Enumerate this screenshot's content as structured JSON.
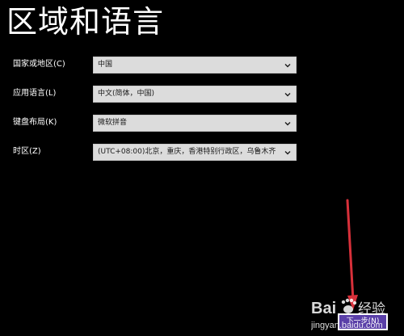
{
  "page": {
    "title": "区域和语言"
  },
  "fields": [
    {
      "label": "国家或地区(C)",
      "value": "中国"
    },
    {
      "label": "应用语言(L)",
      "value": "中文(简体，中国)"
    },
    {
      "label": "键盘布局(K)",
      "value": "微软拼音"
    },
    {
      "label": "时区(Z)",
      "value": "(UTC+08:00)北京，重庆，香港特别行政区，乌鲁木齐"
    }
  ],
  "actions": {
    "next_label": "下一步(N)"
  },
  "watermark": {
    "brand": "Bai",
    "brand_suffix": "经验",
    "url": "jingyan.baidu.com"
  },
  "colors": {
    "background": "#000000",
    "dropdown_bg": "#dcdcdc",
    "next_button_bg": "#5a3fa8",
    "arrow": "#d8303a"
  },
  "icons": {
    "dropdown": "chevron-down-icon",
    "arrow": "red-arrow-annotation",
    "logo": "baidu-paw-icon"
  }
}
